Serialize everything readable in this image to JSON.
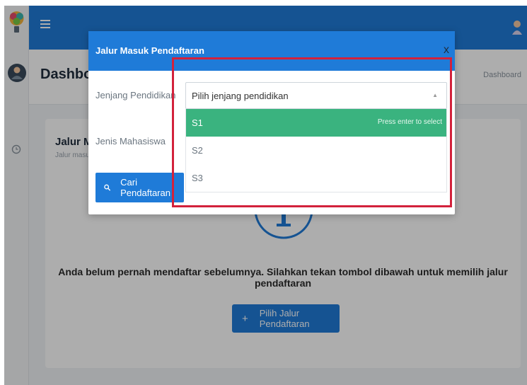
{
  "header": {
    "page_title": "Dashboard",
    "breadcrumb": "Dashboard"
  },
  "card": {
    "title": "Jalur Masuk Pendaftaran",
    "subtitle": "Jalur masuk pendaftaran",
    "empty_message": "Anda belum pernah mendaftar sebelumnya. Silahkan tekan tombol dibawah untuk memilih jalur pendaftaran",
    "choose_button": "Pilih Jalur Pendaftaran",
    "choose_icon": "+"
  },
  "modal": {
    "title": "Jalur Masuk Pendaftaran",
    "close": "x",
    "jenjang_label": "Jenjang Pendidikan",
    "jenis_label": "Jenis Mahasiswa",
    "search_button": "Cari Pendaftaran",
    "select": {
      "value": "Pilih jenjang pendidikan",
      "arrow": "▲",
      "options": [
        "S1",
        "S2",
        "S3"
      ],
      "highlight_hint": "Press enter to select"
    }
  },
  "colors": {
    "primary": "#1f7bd8",
    "highlight": "#3ab37f",
    "annotation": "#d3213b"
  },
  "icons": [
    "logo-icon",
    "hamburger-icon",
    "user-avatar-icon",
    "clock-icon",
    "search-icon",
    "info-icon"
  ]
}
